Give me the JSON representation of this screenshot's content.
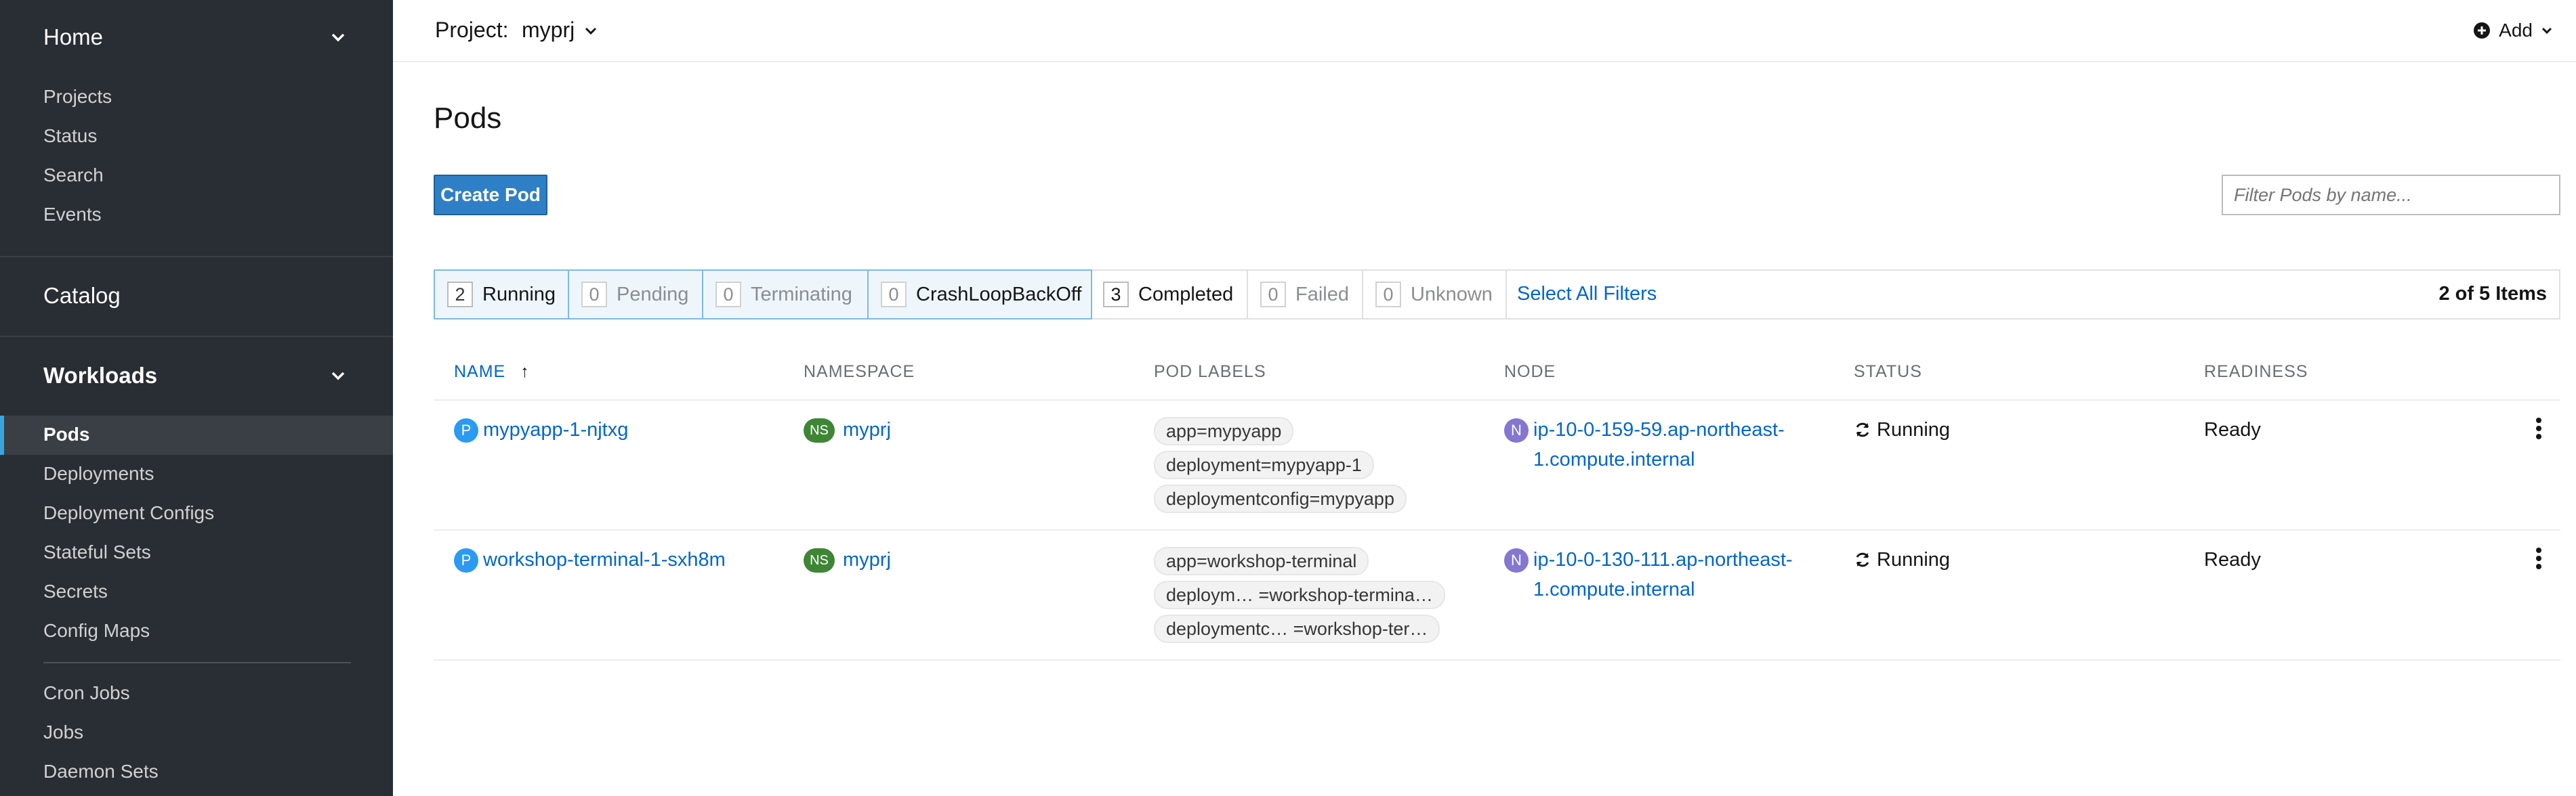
{
  "sidebar": {
    "home": "Home",
    "home_items": [
      "Projects",
      "Status",
      "Search",
      "Events"
    ],
    "catalog": "Catalog",
    "workloads": "Workloads",
    "workload_items": [
      "Pods",
      "Deployments",
      "Deployment Configs",
      "Stateful Sets",
      "Secrets",
      "Config Maps"
    ],
    "workload_items_2": [
      "Cron Jobs",
      "Jobs",
      "Daemon Sets"
    ],
    "active_item": "Pods"
  },
  "topbar": {
    "project_label": "Project:",
    "project_value": "myprj",
    "add_label": "Add"
  },
  "page": {
    "title": "Pods",
    "create_button": "Create Pod",
    "filter_placeholder": "Filter Pods by name..."
  },
  "filters": {
    "chips": [
      {
        "count": "2",
        "label": "Running",
        "selected": true
      },
      {
        "count": "0",
        "label": "Pending",
        "selected": true
      },
      {
        "count": "0",
        "label": "Terminating",
        "selected": true
      },
      {
        "count": "0",
        "label": "CrashLoopBackOff",
        "selected": true
      },
      {
        "count": "3",
        "label": "Completed",
        "selected": false
      },
      {
        "count": "0",
        "label": "Failed",
        "selected": false
      },
      {
        "count": "0",
        "label": "Unknown",
        "selected": false
      }
    ],
    "select_all": "Select All Filters",
    "items_count": "2 of 5 Items"
  },
  "table": {
    "columns": [
      "NAME",
      "NAMESPACE",
      "POD LABELS",
      "NODE",
      "STATUS",
      "READINESS"
    ],
    "sort_indicator": "↑",
    "rows": [
      {
        "pod_badge": "P",
        "name": "mypyapp-1-njtxg",
        "ns_badge": "NS",
        "namespace": "myprj",
        "labels": [
          "app=mypyapp",
          "deployment=mypyapp-1",
          "deploymentconfig=mypyapp"
        ],
        "node_badge": "N",
        "node_line1": "ip-10-0-159-59.ap-northeast-",
        "node_line2": "1.compute.internal",
        "status": "Running",
        "readiness": "Ready"
      },
      {
        "pod_badge": "P",
        "name": "workshop-terminal-1-sxh8m",
        "ns_badge": "NS",
        "namespace": "myprj",
        "labels": [
          "app=workshop-terminal",
          "deploym… =workshop-termina…",
          "deploymentc… =workshop-ter…"
        ],
        "node_badge": "N",
        "node_line1": "ip-10-0-130-111.ap-northeast-",
        "node_line2": "1.compute.internal",
        "status": "Running",
        "readiness": "Ready"
      }
    ]
  },
  "colors": {
    "sidebar_bg": "#292e34",
    "accent": "#0066cc",
    "primary_button": "#2f7fc6"
  },
  "icons": {
    "nav_chevron": "chevron-down-icon",
    "add": "plus-circle-icon",
    "status": "sync-icon",
    "row_actions": "kebab-icon"
  }
}
